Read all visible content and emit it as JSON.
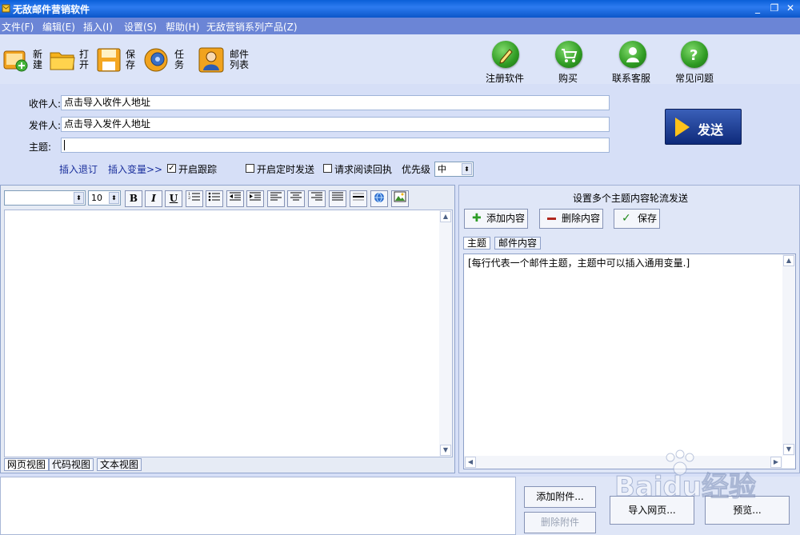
{
  "window": {
    "title": "无敌邮件营销软件"
  },
  "menu": [
    "文件(F)",
    "编辑(E)",
    "插入(I)",
    "设置(S)",
    "帮助(H)",
    "无敌营销系列产品(Z)"
  ],
  "toolbar": {
    "left": [
      {
        "label": "新建",
        "icon": "new-icon"
      },
      {
        "label": "打开",
        "icon": "open-folder-icon"
      },
      {
        "label": "保存",
        "icon": "save-disk-icon"
      },
      {
        "label": "任务",
        "icon": "task-icon"
      },
      {
        "label": "邮件列表",
        "icon": "mail-list-icon"
      }
    ],
    "right": [
      {
        "label": "注册软件",
        "icon": "pencil-icon"
      },
      {
        "label": "购买",
        "icon": "cart-icon"
      },
      {
        "label": "联系客服",
        "icon": "support-icon"
      },
      {
        "label": "常见问题",
        "icon": "question-icon"
      }
    ]
  },
  "form": {
    "recipient_label": "收件人:",
    "recipient_value": "点击导入收件人地址",
    "sender_label": "发件人:",
    "sender_value": "点击导入发件人地址",
    "subject_label": "主题:",
    "subject_value": "",
    "send_label": "发送",
    "insert_unsubscribe": "插入退订",
    "insert_variable": "插入变量>>",
    "tracking_label": "开启跟踪",
    "tracking_checked": true,
    "scheduled_label": "开启定时发送",
    "scheduled_checked": false,
    "receipt_label": "请求阅读回执",
    "receipt_checked": false,
    "priority_label": "优先级",
    "priority_value": "中"
  },
  "editor": {
    "font_name": "",
    "font_size": "10",
    "buttons": [
      "B",
      "I",
      "U"
    ],
    "view_tabs": [
      "网页视图",
      "代码视图",
      "文本视图"
    ],
    "active_view": "网页视图"
  },
  "rotation": {
    "title": "设置多个主题内容轮流发送",
    "add_label": "添加内容",
    "delete_label": "删除内容",
    "save_label": "保存",
    "tabs": [
      "主题",
      "邮件内容"
    ],
    "active_tab": "主题",
    "hint": "[每行代表一个邮件主题，主题中可以插入通用变量.]"
  },
  "bottom": {
    "add_attachment": "添加附件...",
    "delete_attachment": "删除附件",
    "import_page": "导入网页...",
    "preview": "预览..."
  },
  "watermark": {
    "text": "Baidu经验"
  },
  "colors": {
    "accent": "#2d7bf0",
    "send_arrow": "#ffc21a",
    "link": "#1a2f9c"
  }
}
